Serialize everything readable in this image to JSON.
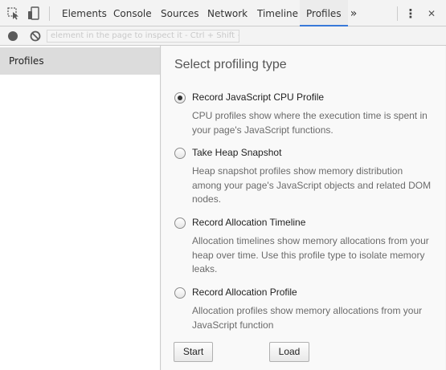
{
  "toolbar": {
    "tabs": [
      "Elements",
      "Console",
      "Sources",
      "Network",
      "Timeline",
      "Profiles"
    ],
    "active_tab": "Profiles",
    "overflow_glyph": "»",
    "menu_glyph": "⋮",
    "close_glyph": "✕",
    "icons": [
      "inspect-element-icon",
      "device-mode-icon",
      "more-tabs-icon",
      "customize-menu-icon",
      "close-icon"
    ]
  },
  "subbar": {
    "hint": "element in the page to inspect it - Ctrl + Shift + C",
    "icons": [
      "record-icon",
      "clear-icon"
    ]
  },
  "sidebar": {
    "items": [
      {
        "label": "Profiles"
      }
    ]
  },
  "main": {
    "heading": "Select profiling type",
    "options": [
      {
        "label": "Record JavaScript CPU Profile",
        "checked": true,
        "description": "CPU profiles show where the execution time is spent in your page's JavaScript functions."
      },
      {
        "label": "Take Heap Snapshot",
        "checked": false,
        "description": "Heap snapshot profiles show memory distribution among your page's JavaScript objects and related DOM nodes."
      },
      {
        "label": "Record Allocation Timeline",
        "checked": false,
        "description": "Allocation timelines show memory allocations from your heap over time. Use this profile type to isolate memory leaks."
      },
      {
        "label": "Record Allocation Profile",
        "checked": false,
        "description": "Allocation profiles show memory allocations from your JavaScript function"
      }
    ],
    "start_label": "Start",
    "load_label": "Load"
  },
  "colors": {
    "active_tab_underline": "#3879d9",
    "sidebar_selected": "#dcdcdc"
  }
}
